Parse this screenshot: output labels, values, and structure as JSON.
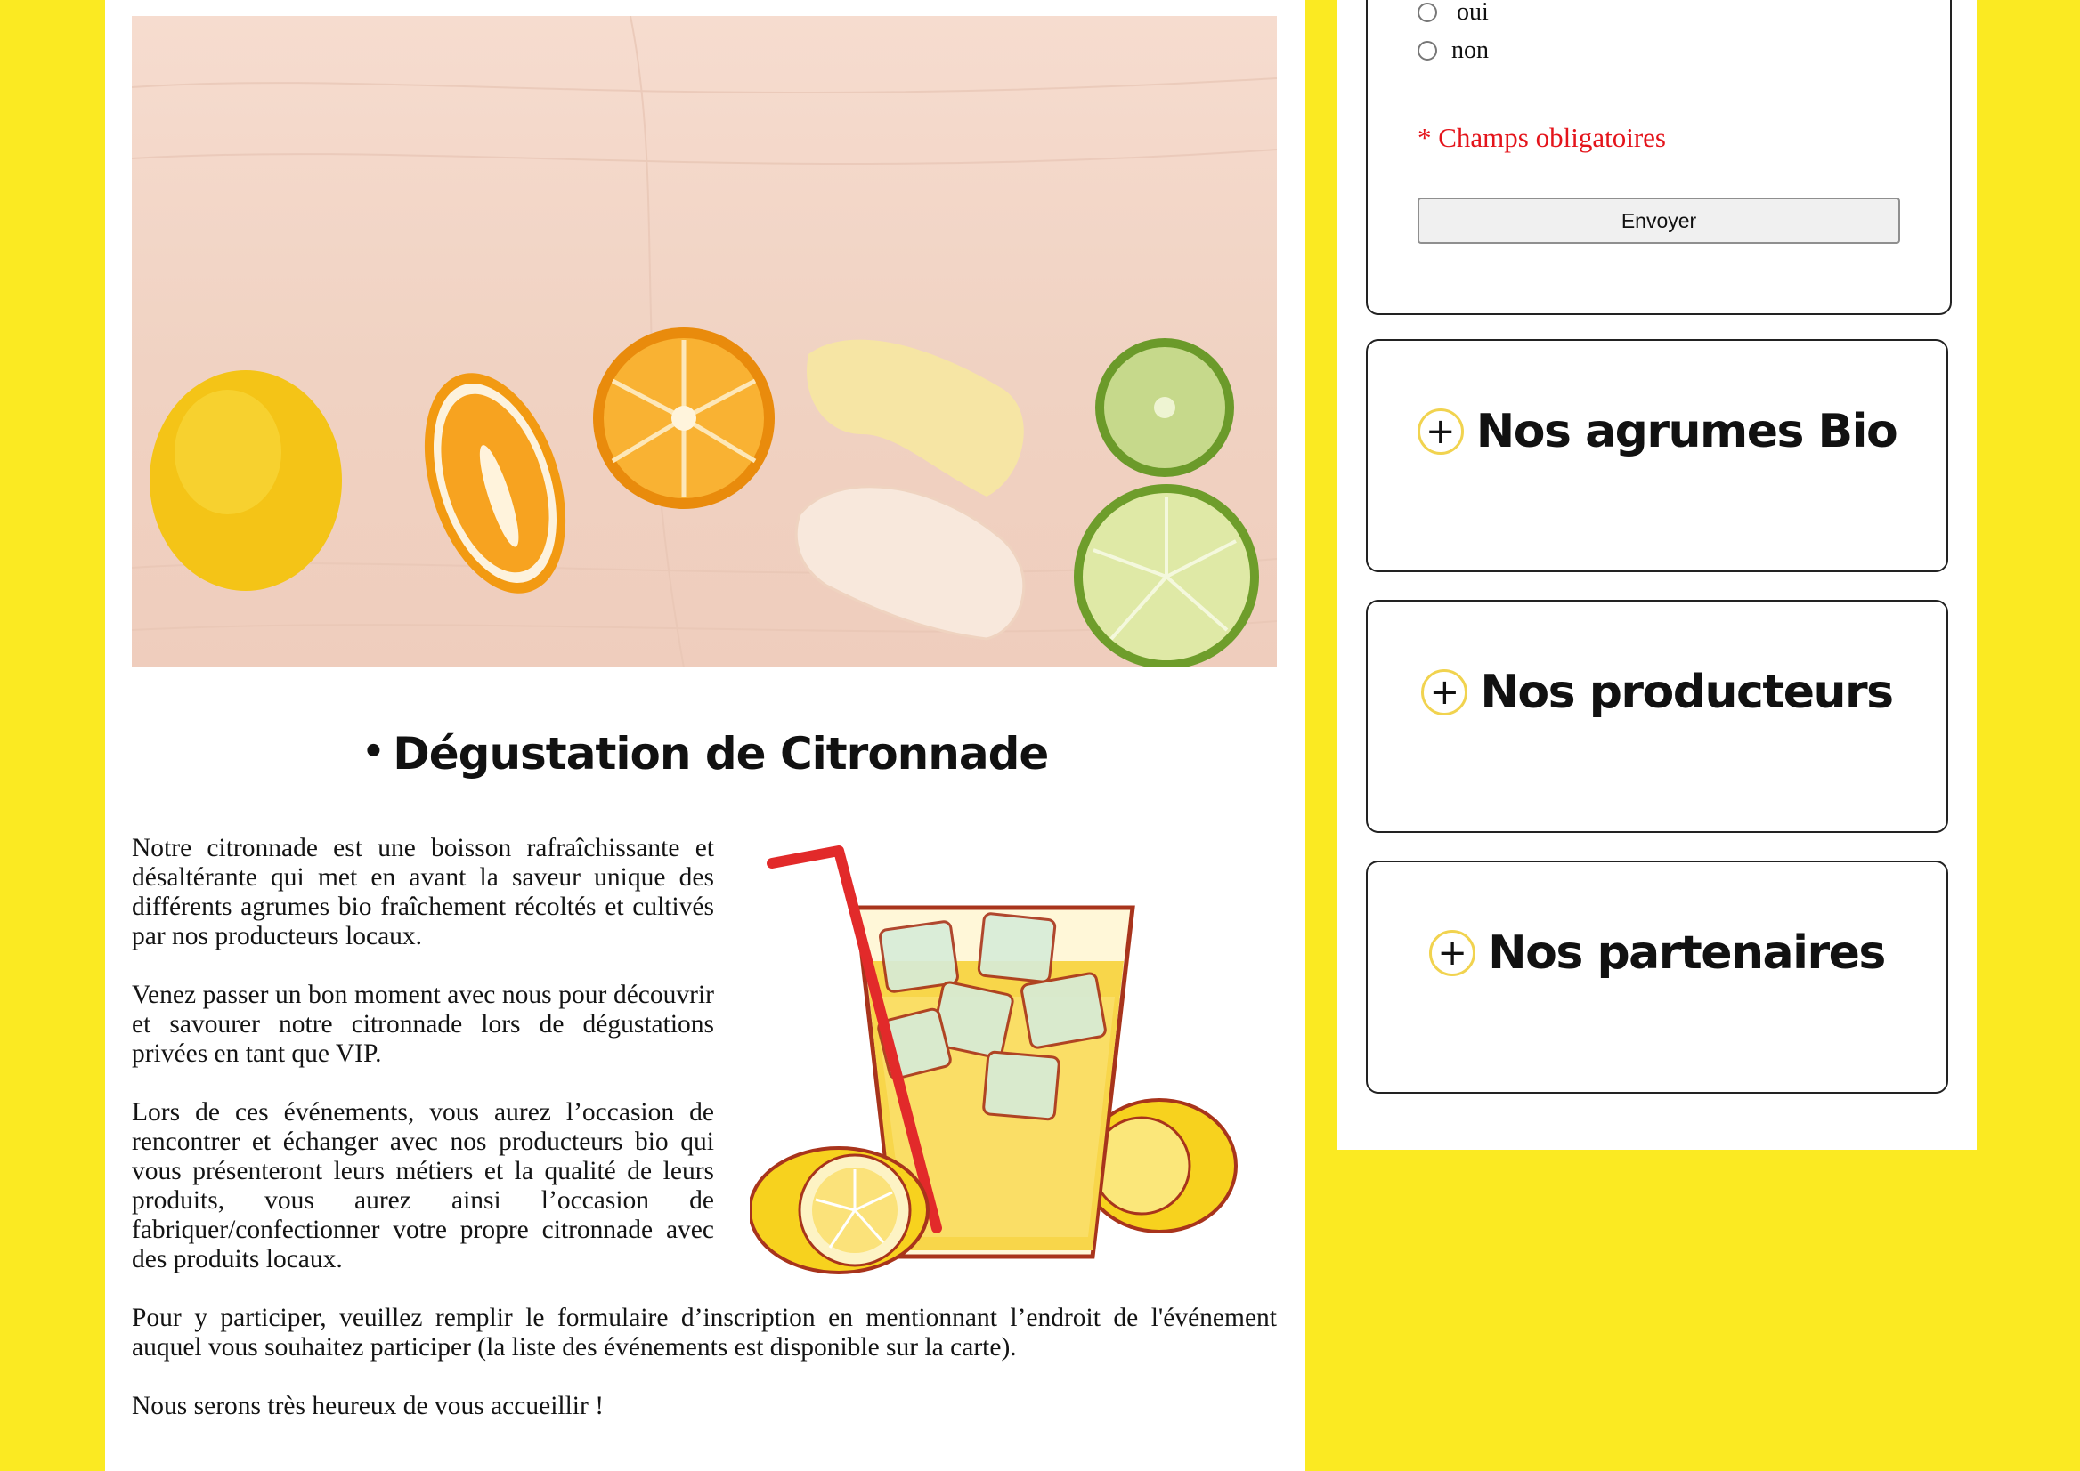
{
  "article": {
    "title": "Dégustation de Citronnade",
    "bullet": "•",
    "paragraphs": [
      "Notre citronnade est une boisson rafraîchissante et désaltérante qui met en avant la saveur unique des différents agrumes bio fraîchement récoltés et cultivés par nos producteurs locaux.",
      "Venez passer un bon moment avec nous pour découvrir et savourer notre citronnade lors de dégustations privées en tant que VIP.",
      "Lors de ces événements, vous aurez l’occasion de rencontrer et échanger avec nos producteurs bio qui vous présenteront leurs métiers et la qualité de leurs produits, vous aurez ainsi l’occasion de fabriquer/confectionner votre propre citronnade avec des produits locaux.",
      "Pour y participer, veuillez remplir le formulaire d’inscription en mentionnant l’endroit de l'événement auquel vous souhaitez participer (la liste des événements est disponible sur la carte).",
      "Nous serons très heureux de vous accueillir !"
    ]
  },
  "form": {
    "radio_options": [
      {
        "label": "oui",
        "checked": false
      },
      {
        "label": "non",
        "checked": false
      }
    ],
    "required_note": "* Champs obligatoires",
    "submit_label": "Envoyer"
  },
  "accordion": [
    {
      "label": "Nos agrumes Bio",
      "icon": "plus-icon"
    },
    {
      "label": "Nos producteurs",
      "icon": "plus-icon"
    },
    {
      "label": "Nos partenaires",
      "icon": "plus-icon"
    }
  ],
  "colors": {
    "page_background": "#fbea22",
    "required_text": "#e4141b",
    "icon_ring": "#f1d34f"
  }
}
